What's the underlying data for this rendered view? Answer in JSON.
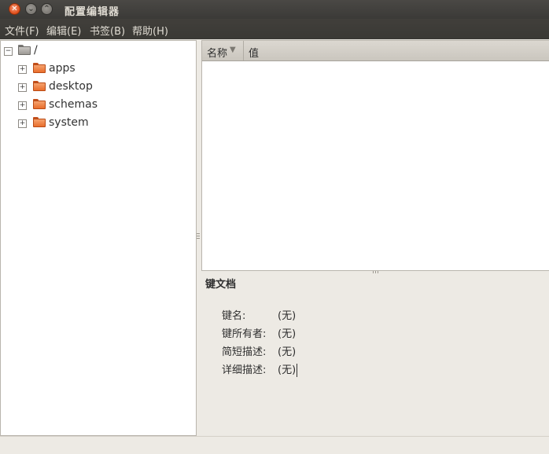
{
  "window": {
    "title": "配置编辑器",
    "close_glyph": "✕",
    "minimize_glyph": "⌄",
    "maximize_glyph": "⌃"
  },
  "menu": [
    "文件(F)",
    "编辑(E)",
    "书签(B)",
    "帮助(H)"
  ],
  "tree": {
    "root": {
      "label": "/",
      "expander": "−"
    },
    "items": [
      {
        "label": "apps",
        "expander": "+"
      },
      {
        "label": "desktop",
        "expander": "+"
      },
      {
        "label": "schemas",
        "expander": "+"
      },
      {
        "label": "system",
        "expander": "+"
      }
    ]
  },
  "list": {
    "columns": {
      "name": "名称",
      "value": "值"
    },
    "sort_indicator": "▼"
  },
  "doc": {
    "title": "键文档",
    "rows": [
      {
        "label": "键名:",
        "value": "(无)"
      },
      {
        "label": "键所有者:",
        "value": "(无)"
      },
      {
        "label": "简短描述:",
        "value": "(无)"
      },
      {
        "label": "详细描述:",
        "value": "(无)"
      }
    ]
  },
  "colors": {
    "titlebar": "#3b3a37",
    "close_button": "#df4b16",
    "folder": "#e96e2c",
    "background": "#edeae4"
  }
}
